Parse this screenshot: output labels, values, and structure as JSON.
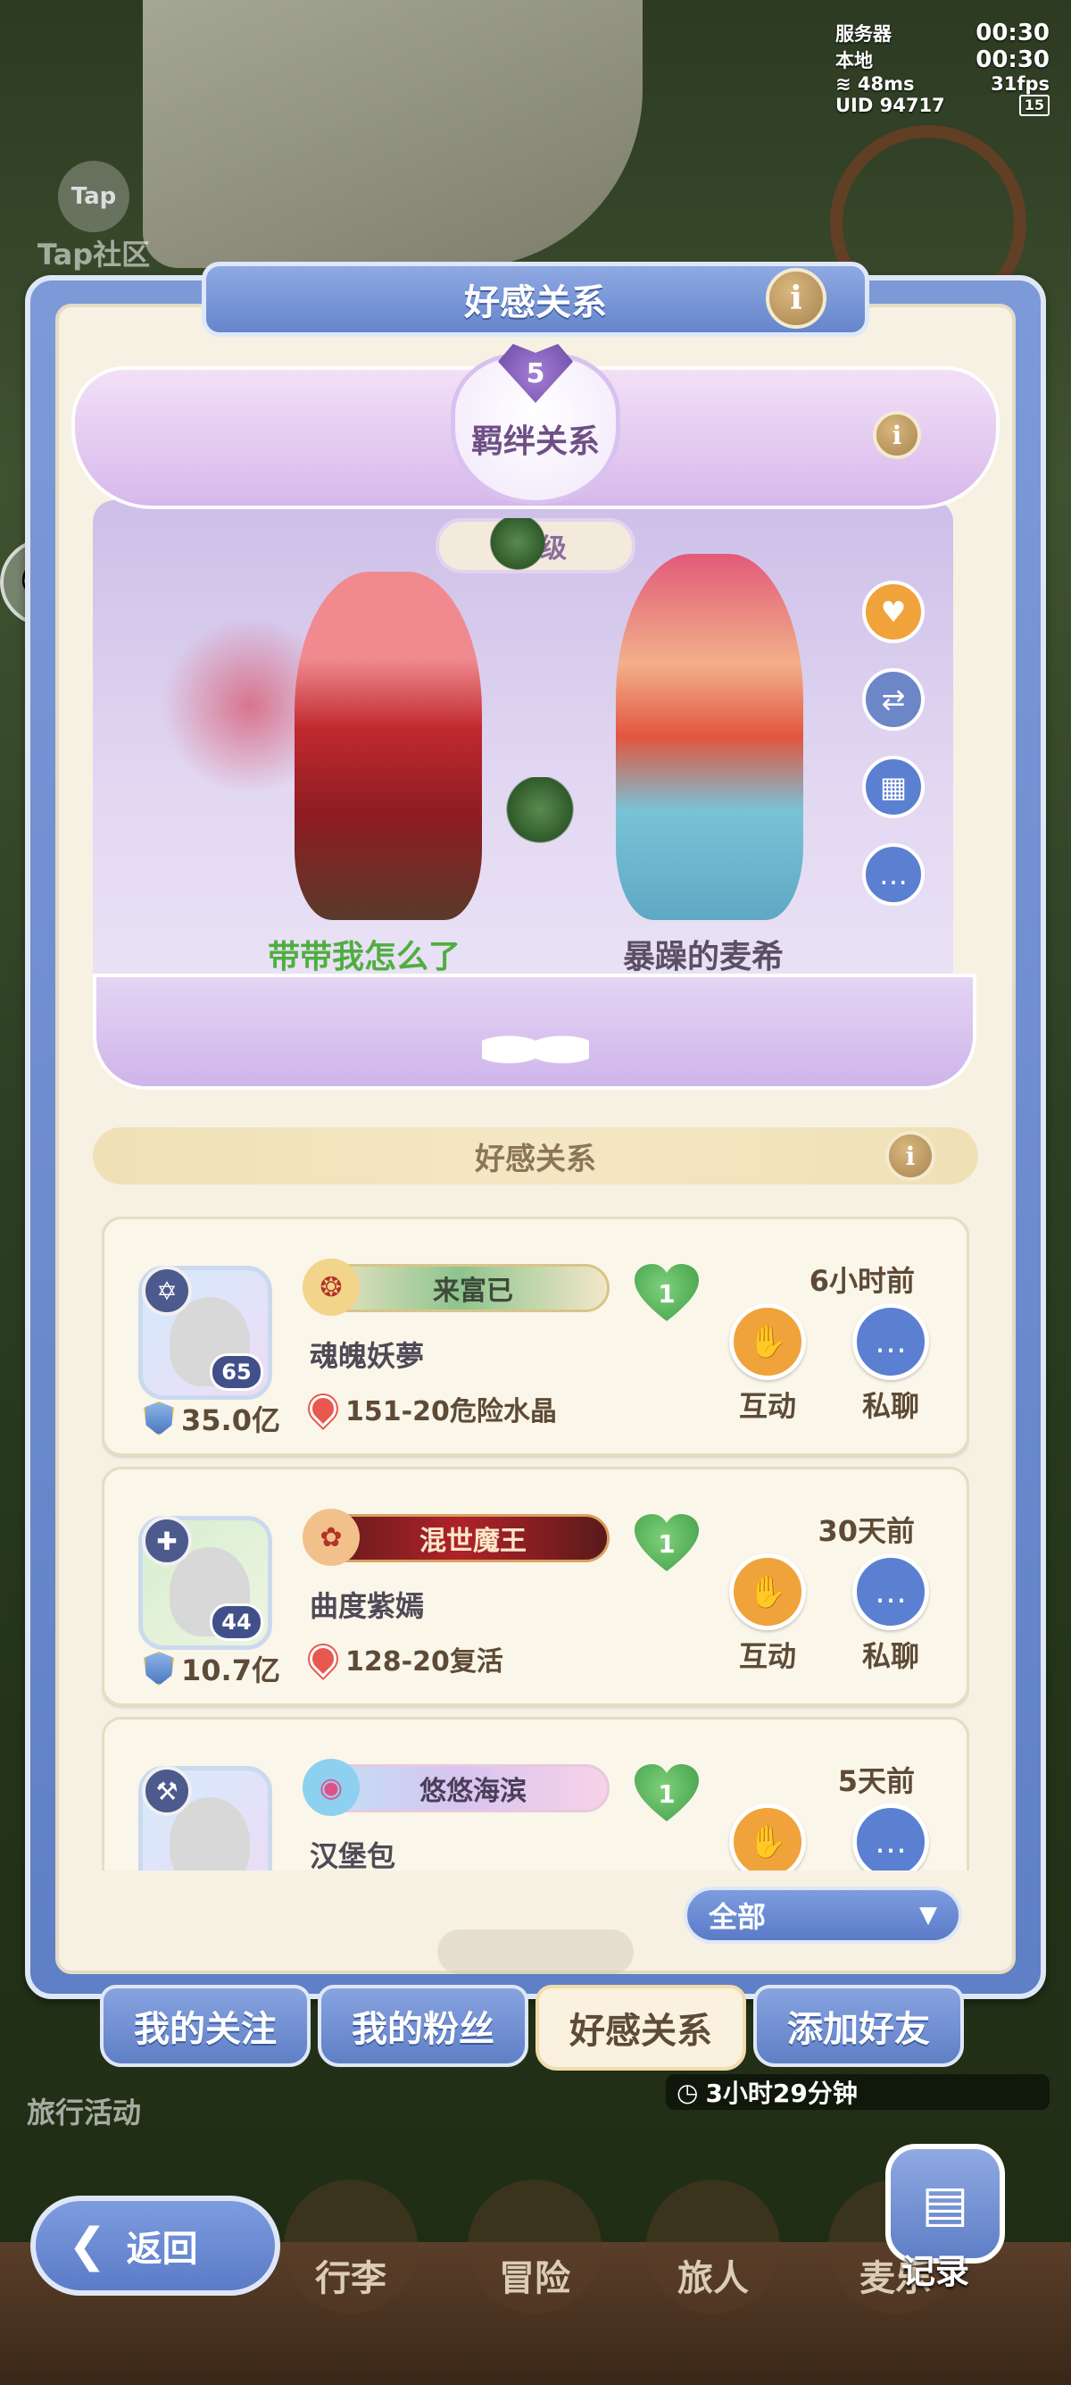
{
  "hud": {
    "server_label": "服务器",
    "server_time": "00:30",
    "local_label": "本地",
    "local_time": "00:30",
    "ping": "48ms",
    "fps": "31fps",
    "uid": "UID 94717",
    "battery": "15"
  },
  "background": {
    "tap_logo": "Tap",
    "tap_label": "Tap社区",
    "travel_event": "旅行活动",
    "timer": "3小时29分钟"
  },
  "panel": {
    "title": "好感关系",
    "info_glyph": "i"
  },
  "bond": {
    "level": "5",
    "title": "羁绊关系",
    "level_chip": "级",
    "left_name": "带带我怎么了",
    "right_name": "暴躁的麦希",
    "left_name_color": "#4fae3f",
    "right_name_color": "#5b4f66",
    "side_icons": [
      "heart-gift-icon",
      "swap-icon",
      "calendar-heart-icon",
      "chat-bubble-icon"
    ]
  },
  "section": {
    "header": "好感关系"
  },
  "friends": [
    {
      "level": "65",
      "power": "35.0亿",
      "title": "来富已",
      "heart": "1",
      "name": "魂魄妖夢",
      "location": "151-20危险水晶",
      "time": "6小时前",
      "interact": "互动",
      "chat": "私聊"
    },
    {
      "level": "44",
      "power": "10.7亿",
      "title": "混世魔王",
      "heart": "1",
      "name": "曲度紫嫣",
      "location": "128-20复活",
      "time": "30天前",
      "interact": "互动",
      "chat": "私聊"
    },
    {
      "level": "",
      "power": "",
      "title": "悠悠海滨",
      "heart": "1",
      "name": "汉堡包",
      "location": "",
      "time": "5天前",
      "interact": "",
      "chat": ""
    }
  ],
  "filter": {
    "value": "全部"
  },
  "tabs": [
    "我的关注",
    "我的粉丝",
    "好感关系",
    "添加好友"
  ],
  "active_tab": "好感关系",
  "bottom_nav": [
    "行李",
    "冒险",
    "旅人",
    "麦乐"
  ],
  "back_button": "返回",
  "record_button": "记录",
  "colors": {
    "panel_blue": "#6686cb",
    "cream": "#f6f1e3",
    "orange_action": "#f0a33b",
    "blue_action": "#5b7fd1",
    "heart_green": "#3c9a44"
  }
}
